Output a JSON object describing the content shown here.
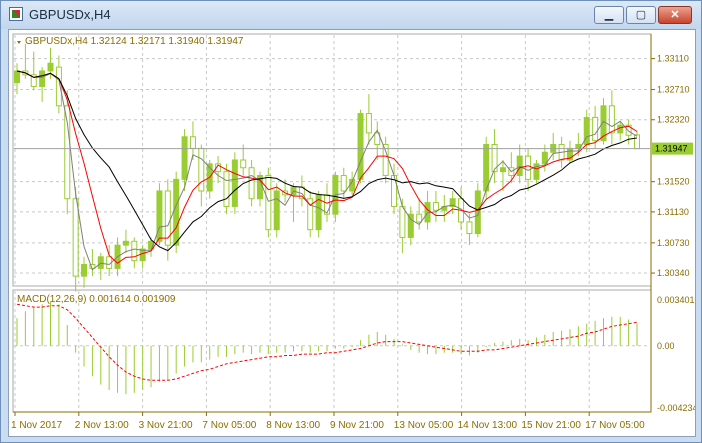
{
  "window": {
    "title": "GBPUSDx,H4",
    "min_glyph": "▁",
    "max_glyph": "▢",
    "close_glyph": "✕"
  },
  "price_panel": {
    "header": "GBPUSDx,H4  1.32124 1.32171 1.31940 1.31947",
    "y_ticks": [
      "1.33110",
      "1.32710",
      "1.32320",
      "1.31520",
      "1.31130",
      "1.30730",
      "1.30340"
    ],
    "current_price": "1.31947"
  },
  "macd_panel": {
    "header": "MACD(12,26,9) 0.001614 0.001909",
    "y_ticks": [
      "0.003401",
      "0.00",
      "-0.004234"
    ]
  },
  "x_labels": [
    "1 Nov 2017",
    "2 Nov 13:00",
    "3 Nov 21:00",
    "7 Nov 05:00",
    "8 Nov 13:00",
    "9 Nov 21:00",
    "13 Nov 05:00",
    "14 Nov 13:00",
    "15 Nov 21:00",
    "17 Nov 05:00"
  ],
  "colors": {
    "candle": "#9acd32",
    "ma_fast": "#808080",
    "ma_mid": "#ff0000",
    "ma_slow": "#000000",
    "macd_hist": "#9acd32",
    "macd_signal": "#ff0000",
    "axis_text": "#8a6d00",
    "grid": "#c8c8c8"
  },
  "chart_data": {
    "type": "candlestick",
    "symbol": "GBPUSDx",
    "timeframe": "H4",
    "ohlc_last": {
      "open": 1.32124,
      "high": 1.32171,
      "low": 1.3194,
      "close": 1.31947
    },
    "candles": [
      [
        1.328,
        1.3305,
        1.3265,
        1.3295
      ],
      [
        1.3295,
        1.333,
        1.3285,
        1.329
      ],
      [
        1.329,
        1.332,
        1.327,
        1.3275
      ],
      [
        1.3275,
        1.33,
        1.3255,
        1.3295
      ],
      [
        1.3295,
        1.3325,
        1.3285,
        1.3305
      ],
      [
        1.33,
        1.3315,
        1.324,
        1.325
      ],
      [
        1.325,
        1.327,
        1.311,
        1.313
      ],
      [
        1.313,
        1.3145,
        1.301,
        1.303
      ],
      [
        1.303,
        1.3055,
        1.3015,
        1.3045
      ],
      [
        1.3045,
        1.3065,
        1.303,
        1.304
      ],
      [
        1.304,
        1.306,
        1.3025,
        1.3055
      ],
      [
        1.3055,
        1.307,
        1.303,
        1.304
      ],
      [
        1.304,
        1.308,
        1.303,
        1.307
      ],
      [
        1.307,
        1.309,
        1.306,
        1.3075
      ],
      [
        1.3075,
        1.308,
        1.304,
        1.305
      ],
      [
        1.305,
        1.307,
        1.304,
        1.3065
      ],
      [
        1.3065,
        1.308,
        1.3055,
        1.3075
      ],
      [
        1.3075,
        1.315,
        1.307,
        1.314
      ],
      [
        1.314,
        1.3155,
        1.305,
        1.307
      ],
      [
        1.307,
        1.3165,
        1.306,
        1.3155
      ],
      [
        1.3155,
        1.322,
        1.314,
        1.321
      ],
      [
        1.321,
        1.323,
        1.318,
        1.3195
      ],
      [
        1.3195,
        1.32,
        1.312,
        1.314
      ],
      [
        1.314,
        1.318,
        1.313,
        1.3175
      ],
      [
        1.3175,
        1.3185,
        1.315,
        1.3165
      ],
      [
        1.3165,
        1.3175,
        1.311,
        1.312
      ],
      [
        1.312,
        1.319,
        1.311,
        1.318
      ],
      [
        1.318,
        1.32,
        1.316,
        1.317
      ],
      [
        1.317,
        1.318,
        1.312,
        1.313
      ],
      [
        1.313,
        1.3165,
        1.312,
        1.316
      ],
      [
        1.316,
        1.317,
        1.308,
        1.309
      ],
      [
        1.309,
        1.315,
        1.308,
        1.314
      ],
      [
        1.314,
        1.3155,
        1.3125,
        1.3135
      ],
      [
        1.3135,
        1.315,
        1.31,
        1.3145
      ],
      [
        1.3145,
        1.316,
        1.312,
        1.313
      ],
      [
        1.313,
        1.314,
        1.308,
        1.309
      ],
      [
        1.309,
        1.314,
        1.308,
        1.3135
      ],
      [
        1.3135,
        1.315,
        1.31,
        1.311
      ],
      [
        1.311,
        1.3165,
        1.31,
        1.316
      ],
      [
        1.316,
        1.317,
        1.313,
        1.314
      ],
      [
        1.314,
        1.3165,
        1.3135,
        1.3155
      ],
      [
        1.3155,
        1.3245,
        1.315,
        1.324
      ],
      [
        1.324,
        1.3265,
        1.32,
        1.3215
      ],
      [
        1.3215,
        1.323,
        1.318,
        1.32
      ],
      [
        1.32,
        1.321,
        1.315,
        1.316
      ],
      [
        1.316,
        1.3175,
        1.311,
        1.312
      ],
      [
        1.312,
        1.313,
        1.306,
        1.308
      ],
      [
        1.308,
        1.312,
        1.307,
        1.311
      ],
      [
        1.311,
        1.313,
        1.309,
        1.31
      ],
      [
        1.31,
        1.314,
        1.309,
        1.3125
      ],
      [
        1.3125,
        1.314,
        1.31,
        1.3115
      ],
      [
        1.3115,
        1.3135,
        1.31,
        1.312
      ],
      [
        1.312,
        1.314,
        1.311,
        1.313
      ],
      [
        1.313,
        1.3145,
        1.309,
        1.31
      ],
      [
        1.31,
        1.311,
        1.307,
        1.3085
      ],
      [
        1.3085,
        1.315,
        1.308,
        1.314
      ],
      [
        1.314,
        1.321,
        1.313,
        1.32
      ],
      [
        1.32,
        1.322,
        1.315,
        1.3165
      ],
      [
        1.3165,
        1.318,
        1.314,
        1.317
      ],
      [
        1.317,
        1.319,
        1.315,
        1.316
      ],
      [
        1.316,
        1.32,
        1.315,
        1.3185
      ],
      [
        1.3185,
        1.3195,
        1.314,
        1.3155
      ],
      [
        1.3155,
        1.318,
        1.315,
        1.3175
      ],
      [
        1.3175,
        1.32,
        1.3165,
        1.319
      ],
      [
        1.319,
        1.3215,
        1.318,
        1.32
      ],
      [
        1.32,
        1.321,
        1.317,
        1.318
      ],
      [
        1.318,
        1.3205,
        1.3175,
        1.3195
      ],
      [
        1.3195,
        1.3215,
        1.3185,
        1.32
      ],
      [
        1.32,
        1.3245,
        1.319,
        1.3235
      ],
      [
        1.3235,
        1.325,
        1.3195,
        1.3205
      ],
      [
        1.3205,
        1.326,
        1.32,
        1.325
      ],
      [
        1.325,
        1.327,
        1.32,
        1.3215
      ],
      [
        1.3215,
        1.323,
        1.3205,
        1.3225
      ],
      [
        1.3225,
        1.3232,
        1.32,
        1.3212
      ],
      [
        1.32124,
        1.32171,
        1.3194,
        1.31947
      ]
    ],
    "macd_histogram": [
      0.002,
      0.0025,
      0.0028,
      0.003,
      0.0032,
      0.003,
      0.0015,
      -0.0005,
      -0.0015,
      -0.0022,
      -0.0028,
      -0.0032,
      -0.0034,
      -0.0035,
      -0.0034,
      -0.0032,
      -0.003,
      -0.0026,
      -0.0025,
      -0.002,
      -0.0015,
      -0.0012,
      -0.0012,
      -0.001,
      -0.0008,
      -0.0008,
      -0.0006,
      -0.0005,
      -0.0006,
      -0.0005,
      -0.0006,
      -0.0005,
      -0.0005,
      -0.0004,
      -0.0004,
      -0.0005,
      -0.0004,
      -0.0004,
      -0.0002,
      -0.0002,
      -0.0001,
      0.0004,
      0.0008,
      0.001,
      0.0008,
      0.0005,
      0.0001,
      -0.0003,
      -0.0005,
      -0.0006,
      -0.0006,
      -0.0005,
      -0.0005,
      -0.0006,
      -0.0007,
      -0.0005,
      -0.0001,
      0.0002,
      0.0003,
      0.0004,
      0.0005,
      0.0004,
      0.0006,
      0.0008,
      0.001,
      0.0011,
      0.0012,
      0.0014,
      0.0016,
      0.0018,
      0.002,
      0.0021,
      0.0021,
      0.0019,
      0.0016
    ],
    "macd_signal": [
      0.003,
      0.0029,
      0.0028,
      0.0028,
      0.0029,
      0.0029,
      0.0026,
      0.002,
      0.0013,
      0.0006,
      -0.0001,
      -0.0008,
      -0.0014,
      -0.0019,
      -0.0022,
      -0.0024,
      -0.0025,
      -0.0025,
      -0.0025,
      -0.0024,
      -0.0022,
      -0.002,
      -0.0018,
      -0.0017,
      -0.0015,
      -0.0013,
      -0.0012,
      -0.0011,
      -0.001,
      -0.0009,
      -0.0008,
      -0.0008,
      -0.0007,
      -0.0007,
      -0.0006,
      -0.0006,
      -0.0006,
      -0.0005,
      -0.0005,
      -0.0004,
      -0.0003,
      -0.0002,
      0.0,
      0.0002,
      0.0003,
      0.0003,
      0.0003,
      0.0002,
      0.0001,
      -0.0,
      -0.0001,
      -0.0002,
      -0.0003,
      -0.0004,
      -0.0004,
      -0.0004,
      -0.0003,
      -0.0003,
      -0.0002,
      -0.0001,
      0.0,
      0.0001,
      0.0002,
      0.0003,
      0.0004,
      0.0005,
      0.0006,
      0.0007,
      0.0009,
      0.001,
      0.0012,
      0.0014,
      0.0015,
      0.0016,
      0.0017
    ],
    "price_ylim": [
      1.3025,
      1.3335
    ],
    "macd_ylim": [
      -0.0045,
      0.0036
    ],
    "grid": true
  }
}
